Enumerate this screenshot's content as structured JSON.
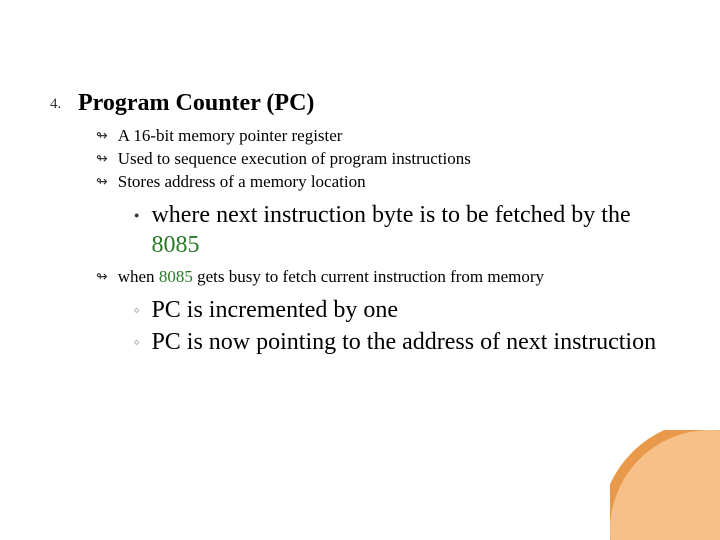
{
  "main": {
    "number": "4.",
    "title": "Program Counter (PC)"
  },
  "bullets": {
    "b1": "A 16-bit memory pointer register",
    "b2": "Used to sequence execution of program instructions",
    "b3": "Stores address of a memory location",
    "sub1_pre": "where next instruction byte is to be fetched by the ",
    "sub1_green": "8085",
    "b4_pre": "when ",
    "b4_green": "8085",
    "b4_post": " gets busy to fetch current instruction from memory",
    "sub2": "PC is incremented by one",
    "sub3": "PC is now pointing to the address of next instruction"
  }
}
